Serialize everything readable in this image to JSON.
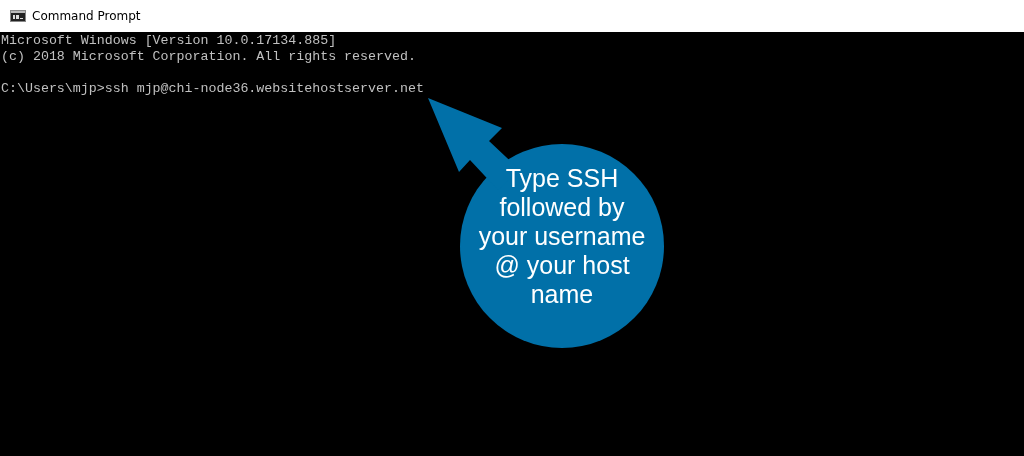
{
  "window": {
    "title": "Command Prompt"
  },
  "console": {
    "banner": [
      "Microsoft Windows [Version 10.0.17134.885]",
      "(c) 2018 Microsoft Corporation. All rights reserved."
    ],
    "command": "C:\\Users\\mjp>ssh mjp@chi-node36.websitehostserver.net"
  },
  "callout": {
    "text": "Type SSH followed by your username @ your host name"
  }
}
